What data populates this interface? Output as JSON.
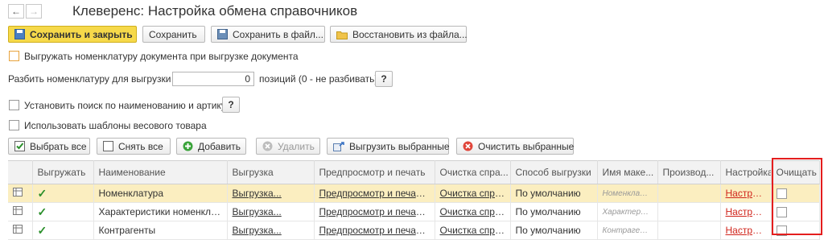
{
  "window": {
    "title": "Клеверенс: Настройка обмена справочников"
  },
  "nav": {
    "back": "←",
    "forward": "→"
  },
  "toolbar": {
    "save_close": "Сохранить и закрыть",
    "save": "Сохранить",
    "save_file": "Сохранить в файл...",
    "restore_file": "Восстановить из файла..."
  },
  "options": {
    "upload_nomenclature": "Выгружать номенклатуру документа при выгрузке документа",
    "split_label": "Разбить номенклатуру для выгрузки по:",
    "split_value": "0",
    "split_suffix": "позиций (0 - не разбивать)",
    "help": "?",
    "search_label": "Установить поиск по наименованию и артикулу",
    "weight_label": "Использовать шаблоны весового товара"
  },
  "actions": {
    "select_all": "Выбрать все",
    "deselect_all": "Снять все",
    "add": "Добавить",
    "delete": "Удалить",
    "upload_selected": "Выгрузить выбранные",
    "clear_selected": "Очистить выбранные"
  },
  "table": {
    "columns": [
      "Выгружать",
      "Наименование",
      "Выгрузка",
      "Предпросмотр и печать",
      "Очистка спра...",
      "Способ выгрузки",
      "Имя маке...",
      "Производ...",
      "Настройка",
      "Очищать"
    ],
    "rows": [
      {
        "export_mark": "✓",
        "name": "Номенклатура",
        "upload": "Выгрузка...",
        "preview": "Предпросмотр и печать...",
        "clear": "Очистка спра...",
        "method": "По умолчанию",
        "layout": "Номенклату..",
        "producer": "",
        "settings": "Настроить"
      },
      {
        "export_mark": "✓",
        "name": "Характеристики номенклат...",
        "upload": "Выгрузка...",
        "preview": "Предпросмотр и печать...",
        "clear": "Очистка спра...",
        "method": "По умолчанию",
        "layout": "Характерис..",
        "producer": "",
        "settings": "Настроить"
      },
      {
        "export_mark": "✓",
        "name": "Контрагенты",
        "upload": "Выгрузка...",
        "preview": "Предпросмотр и печать...",
        "clear": "Очистка спра...",
        "method": "По умолчанию",
        "layout": "Контрагенты",
        "producer": "",
        "settings": "Настроить"
      }
    ]
  },
  "colors": {
    "accent": "#f6d94a",
    "selected_row": "#fbeec0",
    "link_red": "#d0241b",
    "highlight": "#e41e1e",
    "check_green": "#2a8f2a"
  }
}
